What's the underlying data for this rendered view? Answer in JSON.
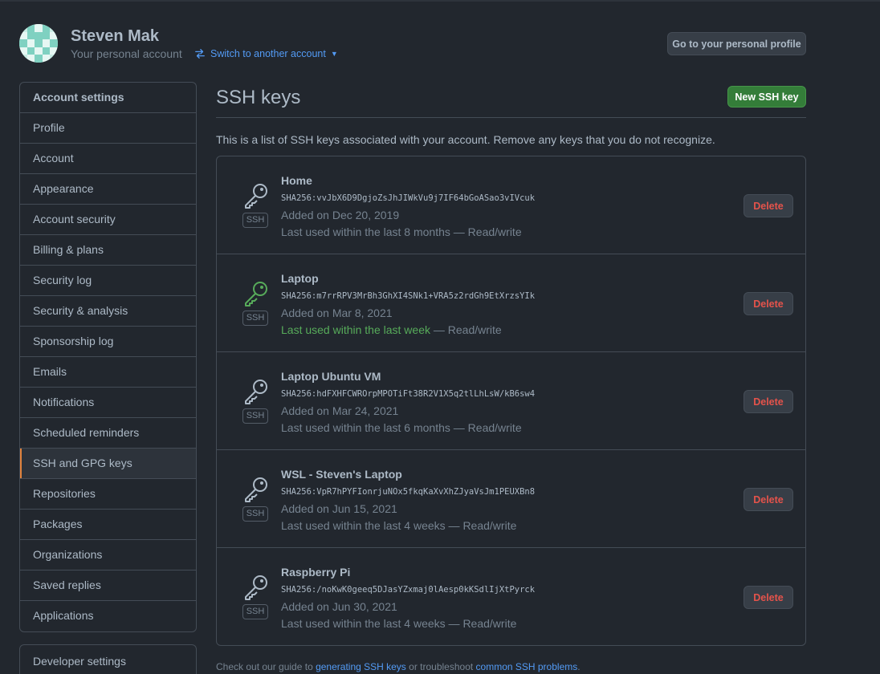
{
  "header": {
    "name": "Steven Mak",
    "subtitle": "Your personal account",
    "switch_label": "Switch to another account",
    "profile_button": "Go to your personal profile"
  },
  "sidebar": {
    "items": [
      {
        "label": "Account settings"
      },
      {
        "label": "Profile"
      },
      {
        "label": "Account"
      },
      {
        "label": "Appearance"
      },
      {
        "label": "Account security"
      },
      {
        "label": "Billing & plans"
      },
      {
        "label": "Security log"
      },
      {
        "label": "Security & analysis"
      },
      {
        "label": "Sponsorship log"
      },
      {
        "label": "Emails"
      },
      {
        "label": "Notifications"
      },
      {
        "label": "Scheduled reminders"
      },
      {
        "label": "SSH and GPG keys"
      },
      {
        "label": "Repositories"
      },
      {
        "label": "Packages"
      },
      {
        "label": "Organizations"
      },
      {
        "label": "Saved replies"
      },
      {
        "label": "Applications"
      }
    ],
    "developer": "Developer settings"
  },
  "main": {
    "title": "SSH keys",
    "new_button": "New SSH key",
    "description": "This is a list of SSH keys associated with your account. Remove any keys that you do not recognize.",
    "badge": "SSH",
    "delete_label": "Delete",
    "keys": [
      {
        "name": "Home",
        "fingerprint": "SHA256:vvJbX6D9DgjoZsJhJIWkVu9j7IF64bGoASao3vIVcuk",
        "added": "Added on Dec 20, 2019",
        "used": "Last used within the last 8 months",
        "access": " — Read/write",
        "recent": false
      },
      {
        "name": "Laptop",
        "fingerprint": "SHA256:m7rrRPV3MrBh3GhXI4SNk1+VRA5z2rdGh9EtXrzsYIk",
        "added": "Added on Mar 8, 2021",
        "used": "Last used within the last week",
        "access": " — Read/write",
        "recent": true
      },
      {
        "name": "Laptop Ubuntu VM",
        "fingerprint": "SHA256:hdFXHFCWROrpMPOTiFt38R2V1X5q2tlLhLsW/kB6sw4",
        "added": "Added on Mar 24, 2021",
        "used": "Last used within the last 6 months",
        "access": " — Read/write",
        "recent": false
      },
      {
        "name": "WSL - Steven's Laptop",
        "fingerprint": "SHA256:VpR7hPYFIonrjuNOx5fkqKaXvXhZJyaVsJm1PEUXBn8",
        "added": "Added on Jun 15, 2021",
        "used": "Last used within the last 4 weeks",
        "access": " — Read/write",
        "recent": false
      },
      {
        "name": "Raspberry Pi",
        "fingerprint": "SHA256:/noKwK0geeq5DJasYZxmaj0lAesp0kKSdlIjXtPyrck",
        "added": "Added on Jun 30, 2021",
        "used": "Last used within the last 4 weeks",
        "access": " — Read/write",
        "recent": false
      }
    ]
  },
  "footer": {
    "prefix": "Check out our guide to ",
    "link1": "generating SSH keys",
    "middle": " or troubleshoot ",
    "link2": "common SSH problems",
    "suffix": "."
  },
  "colors": {
    "accent_green": "#347d39",
    "recent_green": "#57ab5a",
    "danger": "#e5534b",
    "link": "#539bf5",
    "active_marker": "#e0823d"
  },
  "icons": [
    "switch-arrows-icon",
    "caret-down-icon",
    "key-icon"
  ]
}
